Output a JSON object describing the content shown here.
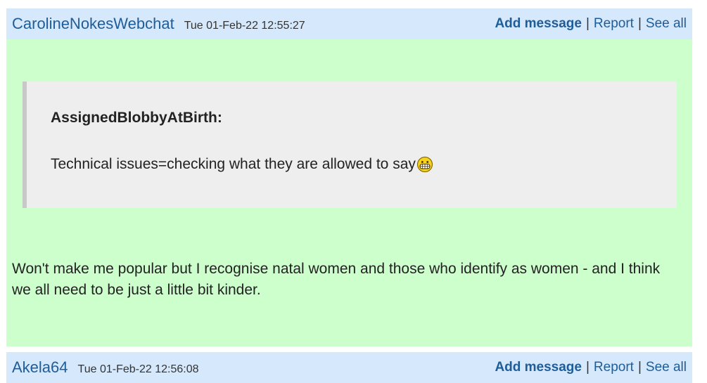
{
  "posts": [
    {
      "username": "CarolineNokesWebchat",
      "timestamp": "Tue 01-Feb-22 12:55:27",
      "actions": {
        "add_message": "Add message",
        "report": "Report",
        "see_all": "See all",
        "separator": "|"
      },
      "quote": {
        "author": "AssignedBlobbyAtBirth:",
        "text": "Technical issues=checking what they are allowed to say",
        "emoji": "grinning-face-icon"
      },
      "message": "Won't make me popular but I recognise natal women and those who identify as women - and I think we all need to be just a little bit kinder."
    },
    {
      "username": "Akela64",
      "timestamp": "Tue 01-Feb-22 12:56:08",
      "actions": {
        "add_message": "Add message",
        "report": "Report",
        "see_all": "See all",
        "separator": "|"
      }
    }
  ],
  "colors": {
    "header_bg": "#d6e8fb",
    "body_bg": "#ccffcc",
    "quote_bg": "#eeeeee",
    "link": "#1f5d99"
  }
}
